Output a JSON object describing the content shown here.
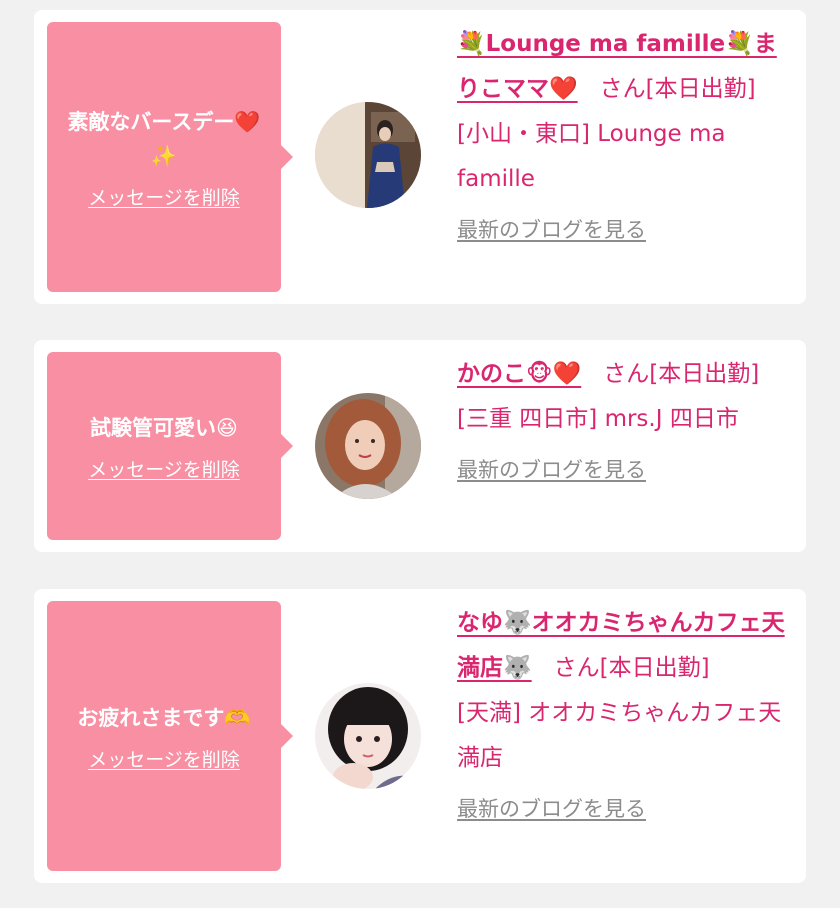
{
  "cards": [
    {
      "message": "素敵なバースデー❤️✨",
      "delete_label": "メッセージを削除",
      "name": "💐Lounge ma famille💐まりこママ❤️",
      "honorific": "さん[本日出勤]",
      "location": "[小山・東口] Lounge ma famille",
      "blog_label": "最新のブログを見る"
    },
    {
      "message": "試験管可愛い😆",
      "delete_label": "メッセージを削除",
      "name": "かのこ🐵❤️",
      "honorific": "さん[本日出勤]",
      "location": "[三重 四日市] mrs.J 四日市",
      "blog_label": "最新のブログを見る"
    },
    {
      "message": "お疲れさまです🫶",
      "delete_label": "メッセージを削除",
      "name": "なゆ🐺オオカミちゃんカフェ天満店🐺",
      "honorific": "さん[本日出勤]",
      "location": "[天満] オオカミちゃんカフェ天満店",
      "blog_label": "最新のブログを見る"
    }
  ],
  "colors": {
    "page_bg": "#f1f1f2",
    "bubble": "#f88fa3",
    "accent_pink": "#d9266f",
    "link_gray": "#8c8c8c"
  }
}
